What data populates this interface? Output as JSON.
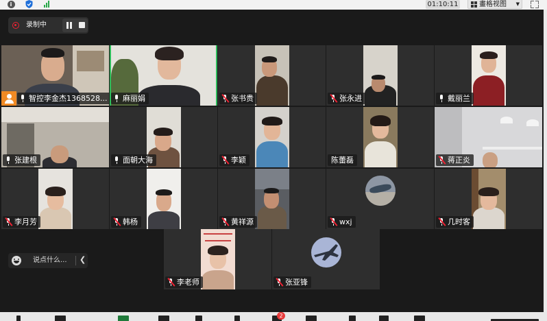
{
  "topbar": {
    "timer": "01:10:11",
    "view_button": "畫格视图",
    "info_icon": "info-icon",
    "shield_icon": "shield-icon",
    "signal_icon": "signal-icon",
    "fullscreen_icon": "fullscreen-icon"
  },
  "recording": {
    "label": "录制中",
    "accent": "#e62e3b"
  },
  "participants": [
    {
      "name": "智控李金杰1368528...",
      "muted": false,
      "host": true
    },
    {
      "name": "麻丽娟",
      "muted": false,
      "speaking": true
    },
    {
      "name": "张书贵",
      "muted": true
    },
    {
      "name": "张永进",
      "muted": true
    },
    {
      "name": "戴丽兰",
      "muted": false
    },
    {
      "name": "张建根",
      "muted": false
    },
    {
      "name": "面朝大海",
      "muted": false
    },
    {
      "name": "李颖",
      "muted": true
    },
    {
      "name": "陈蕾磊",
      "muted": false,
      "no_icon": true
    },
    {
      "name": "蒋正炎",
      "muted": true
    },
    {
      "name": "李月芳",
      "muted": true
    },
    {
      "name": "韩杨",
      "muted": true
    },
    {
      "name": "黄祥源",
      "muted": true
    },
    {
      "name": "wxj",
      "muted": true
    },
    {
      "name": "几时客",
      "muted": true
    },
    {
      "name": "李老师",
      "muted": true
    },
    {
      "name": "张亚锋",
      "muted": true
    }
  ],
  "chat": {
    "placeholder": "说点什么...",
    "emoji_icon": "smile-icon",
    "collapse_icon": "chevron-left-icon"
  },
  "toolbar": {
    "chat_badge": "2"
  },
  "colors": {
    "active_speaker": "#2ebd5b",
    "host_badge": "#f08a24",
    "tile_bg": "#2e2e2e"
  }
}
